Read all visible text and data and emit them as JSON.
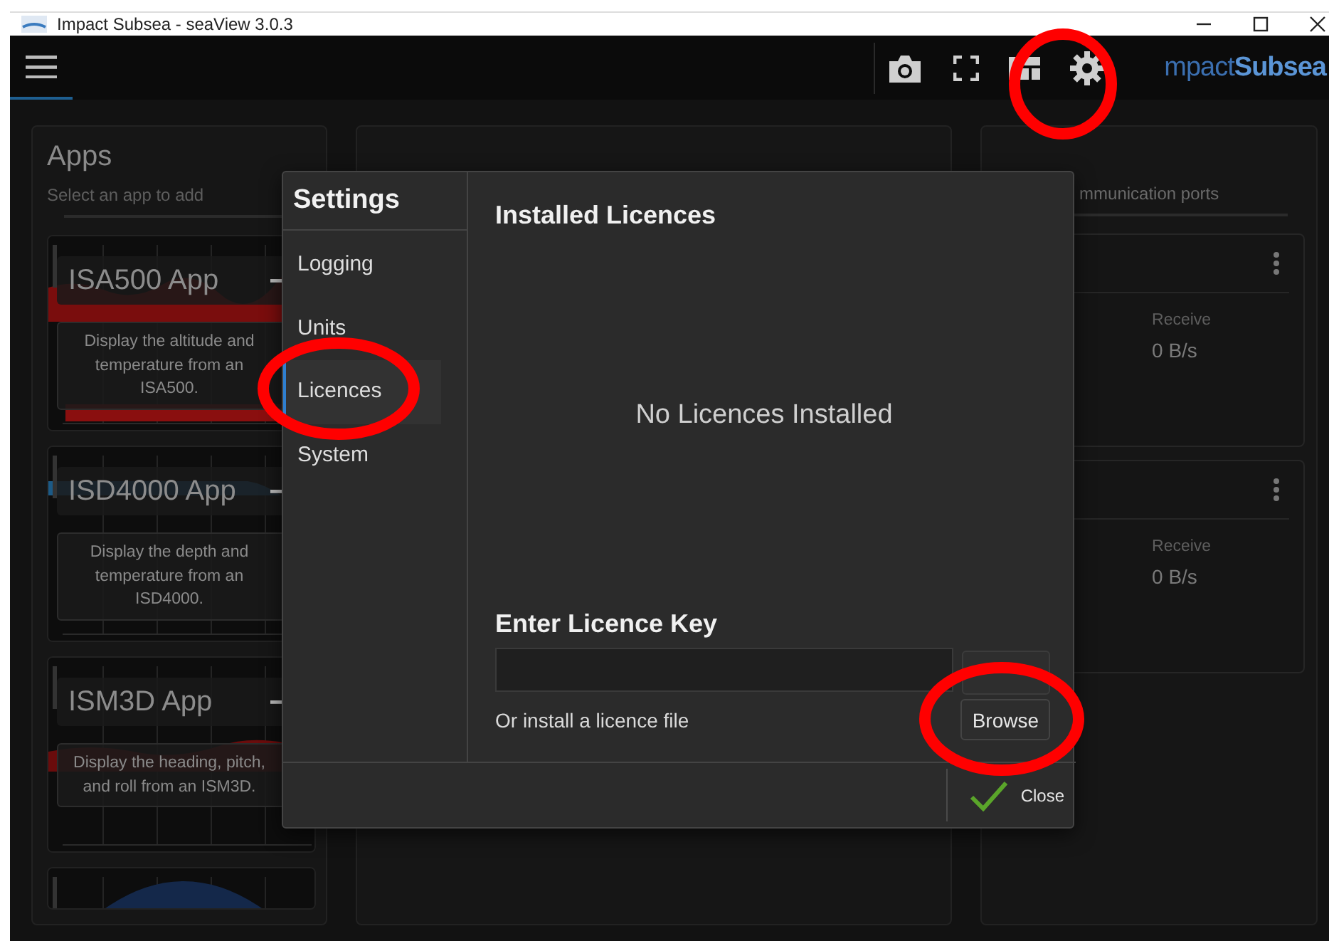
{
  "window": {
    "title": "Impact Subsea - seaView 3.0.3"
  },
  "toolbar": {
    "logo": "mpact**Subsea**"
  },
  "apps_panel": {
    "title": "Apps",
    "subtitle": "Select an app to add",
    "apps": [
      {
        "kind": "altitude",
        "title": "ISA500 App",
        "description": "Display the altitude and temperature from an ISA500."
      },
      {
        "kind": "depth",
        "title": "ISD4000 App",
        "description": "Display the depth and temperature from an ISD4000."
      },
      {
        "kind": "heading",
        "title": "ISM3D App",
        "description": "Display the heading, pitch, and roll from an ISM3D."
      },
      {
        "kind": "sonar"
      }
    ]
  },
  "comms_panel": {
    "subtitle": "mmunication ports",
    "ports": [
      {
        "receive_label": "Receive",
        "receive_rate": "0 B/s"
      },
      {
        "receive_label": "Receive",
        "receive_rate": "0 B/s"
      }
    ]
  },
  "settings_dialog": {
    "title": "Settings",
    "nav": [
      {
        "label": "Logging",
        "selected": false
      },
      {
        "label": "Units",
        "selected": false
      },
      {
        "label": "Licences",
        "selected": true
      },
      {
        "label": "System",
        "selected": false
      }
    ],
    "installed_heading": "Installed Licences",
    "empty_message": "No Licences Installed",
    "key_heading": "Enter Licence Key",
    "file_label": "Or install a licence file",
    "browse_button": "Browse",
    "close_button": "Close"
  }
}
